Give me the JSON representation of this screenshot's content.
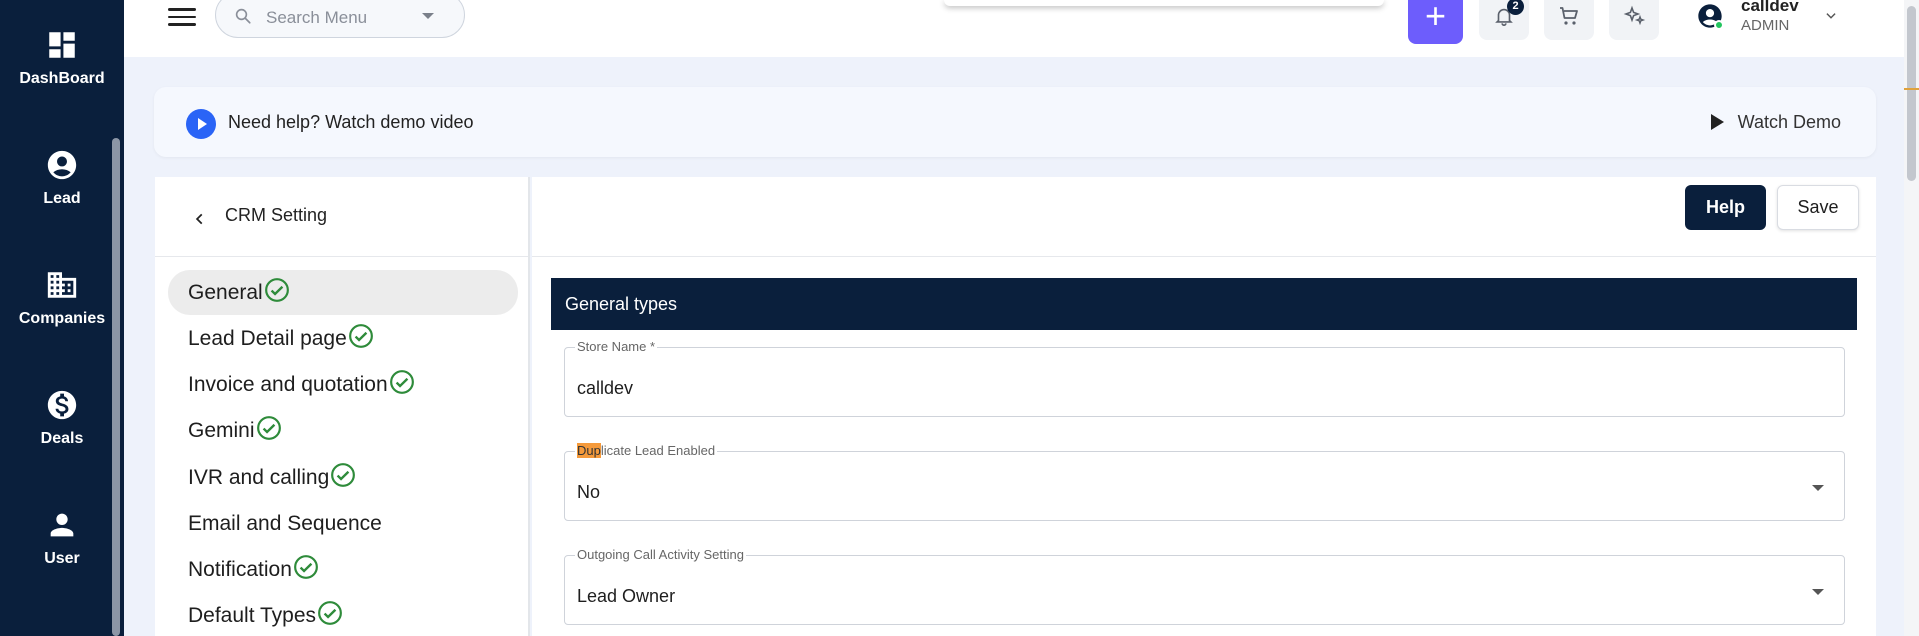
{
  "sidebar": {
    "items": [
      {
        "label": "DashBoard",
        "icon": "dashboard-icon"
      },
      {
        "label": "Lead",
        "icon": "account-circle-icon"
      },
      {
        "label": "Companies",
        "icon": "building-icon"
      },
      {
        "label": "Deals",
        "icon": "dollar-circle-icon"
      },
      {
        "label": "User",
        "icon": "person-icon"
      }
    ]
  },
  "topbar": {
    "search_placeholder": "Search Menu",
    "add_label": "+",
    "notification_count": "2",
    "user": {
      "name": "calldev",
      "role": "ADMIN"
    }
  },
  "banner": {
    "text": "Need help? Watch demo video",
    "watch_label": "Watch Demo"
  },
  "settings": {
    "title": "CRM Setting",
    "items": [
      {
        "label": "General",
        "checked": true,
        "active": true
      },
      {
        "label": "Lead Detail page",
        "checked": true
      },
      {
        "label": "Invoice and quotation",
        "checked": true
      },
      {
        "label": "Gemini",
        "checked": true
      },
      {
        "label": "IVR and calling",
        "checked": true
      },
      {
        "label": "Email and Sequence",
        "checked": false
      },
      {
        "label": "Notification",
        "checked": true
      },
      {
        "label": "Default Types",
        "checked": true
      }
    ]
  },
  "content": {
    "help_label": "Help",
    "save_label": "Save",
    "section_title": "General types",
    "fields": {
      "store_name": {
        "label": "Store Name *",
        "value": "calldev"
      },
      "duplicate_lead": {
        "label_highlight": "Dup",
        "label_rest": "licate Lead Enabled",
        "value": "No"
      },
      "outgoing_call": {
        "label": "Outgoing Call Activity Setting",
        "value": "Lead Owner"
      }
    }
  },
  "colors": {
    "nav_bg": "#0a1f3c",
    "accent_purple": "#6d5dfc",
    "play_blue": "#2a64f6",
    "check_green": "#2e8b3a",
    "highlight_orange": "#f59a3b"
  }
}
